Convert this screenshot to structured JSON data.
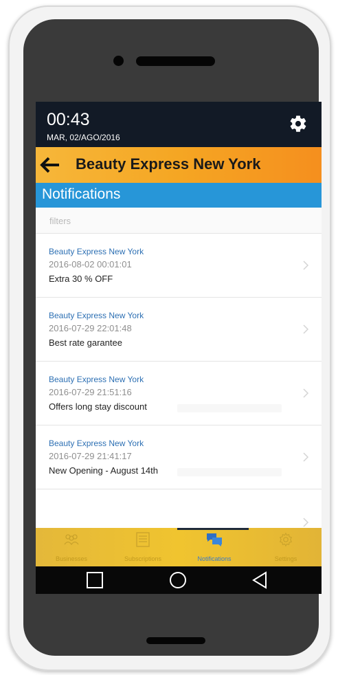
{
  "status": {
    "time": "00:43",
    "date": "MAR, 02/AGO/2016"
  },
  "app_bar": {
    "title": "Beauty Express New York"
  },
  "section": {
    "title": "Notifications"
  },
  "filters": {
    "placeholder": "filters"
  },
  "notifications": [
    {
      "business": "Beauty Express New York",
      "timestamp": "2016-08-02 00:01:01",
      "message": "Extra 30 % OFF"
    },
    {
      "business": "Beauty Express New York",
      "timestamp": "2016-07-29 22:01:48",
      "message": "Best rate garantee"
    },
    {
      "business": "Beauty Express New York",
      "timestamp": "2016-07-29 21:51:16",
      "message": "Offers long stay discount"
    },
    {
      "business": "Beauty Express New York",
      "timestamp": "2016-07-29 21:41:17",
      "message": "New Opening - August 14th"
    }
  ],
  "bottom_nav": {
    "items": [
      {
        "label": "Businesses",
        "icon": "people-icon"
      },
      {
        "label": "Subscriptions",
        "icon": "list-icon"
      },
      {
        "label": "Notifications",
        "icon": "chat-icon",
        "active": true
      },
      {
        "label": "Settings",
        "icon": "gear-icon"
      }
    ]
  },
  "colors": {
    "status_bar": "#121a26",
    "app_bar": "#f5a623",
    "section_bar": "#2796d8",
    "bottom_nav": "#f0c42f",
    "link_blue": "#2c6fb3"
  }
}
